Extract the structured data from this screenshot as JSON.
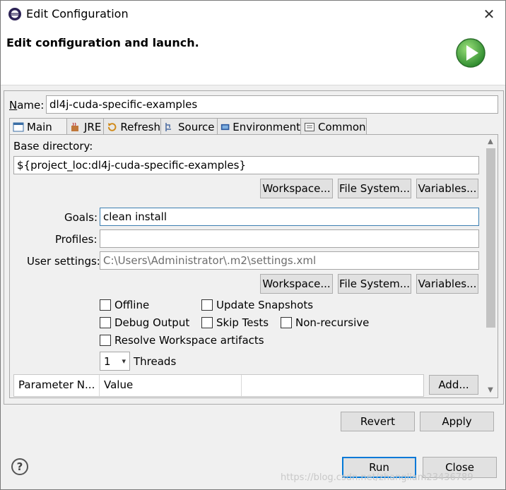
{
  "window": {
    "title": "Edit Configuration"
  },
  "header": {
    "title": "Edit configuration and launch."
  },
  "name_field": {
    "label": "Name:",
    "value": "dl4j-cuda-specific-examples"
  },
  "tabs": [
    {
      "label": "Main",
      "icon": "main-icon"
    },
    {
      "label": "JRE",
      "icon": "jre-icon"
    },
    {
      "label": "Refresh",
      "icon": "refresh-icon"
    },
    {
      "label": "Source",
      "icon": "source-icon"
    },
    {
      "label": "Environment",
      "icon": "environment-icon"
    },
    {
      "label": "Common",
      "icon": "common-icon"
    }
  ],
  "main": {
    "base_dir_label": "Base directory:",
    "base_dir_value": "${project_loc:dl4j-cuda-specific-examples}",
    "workspace_btn": "Workspace...",
    "filesystem_btn": "File System...",
    "variables_btn": "Variables...",
    "goals_label": "Goals:",
    "goals_value": "clean install",
    "profiles_label": "Profiles:",
    "profiles_value": "",
    "user_settings_label": "User settings:",
    "user_settings_value": "C:\\Users\\Administrator\\.m2\\settings.xml",
    "workspace_btn2": "Workspace...",
    "filesystem_btn2": "File System...",
    "variables_btn2": "Variables...",
    "offline": "Offline",
    "update_snapshots": "Update Snapshots",
    "debug_output": "Debug Output",
    "skip_tests": "Skip Tests",
    "non_recursive": "Non-recursive",
    "resolve_workspace": "Resolve Workspace artifacts",
    "threads_value": "1",
    "threads_label": "Threads",
    "table_col_param": "Parameter N...",
    "table_col_value": "Value",
    "add_btn": "Add..."
  },
  "footer": {
    "revert": "Revert",
    "apply": "Apply",
    "run": "Run",
    "close": "Close"
  },
  "watermark": "https://blog.csdn.net/zhangliam23436789",
  "colors": {
    "accent": "#0078d7",
    "run_green": "#43a047"
  }
}
